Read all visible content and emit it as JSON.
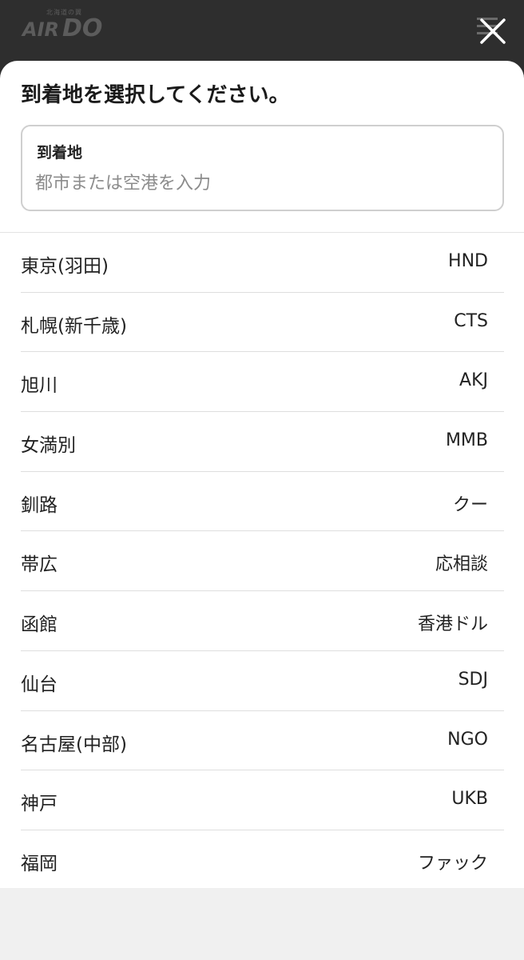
{
  "header": {
    "logo_tagline": "北海道の翼",
    "logo_air": "AIR",
    "logo_do": "DO",
    "close_icon": "close-icon",
    "menu_icon": "hamburger-menu-icon"
  },
  "sheet": {
    "title": "到着地を選択してください。",
    "search": {
      "label": "到着地",
      "placeholder": "都市または空港を入力",
      "value": ""
    }
  },
  "airports": [
    {
      "city": "東京(羽田)",
      "code": "HND"
    },
    {
      "city": "札幌(新千歳)",
      "code": "CTS"
    },
    {
      "city": "旭川",
      "code": "AKJ"
    },
    {
      "city": "女満別",
      "code": "MMB"
    },
    {
      "city": "釧路",
      "code": "クー"
    },
    {
      "city": "帯広",
      "code": "応相談"
    },
    {
      "city": "函館",
      "code": "香港ドル"
    },
    {
      "city": "仙台",
      "code": "SDJ"
    },
    {
      "city": "名古屋(中部)",
      "code": "NGO"
    },
    {
      "city": "神戸",
      "code": "UKB"
    },
    {
      "city": "福岡",
      "code": "ファック"
    }
  ],
  "colors": {
    "header_bg": "#2e2e2e",
    "sheet_bg": "#ffffff",
    "page_bg": "#f0f0f0"
  }
}
